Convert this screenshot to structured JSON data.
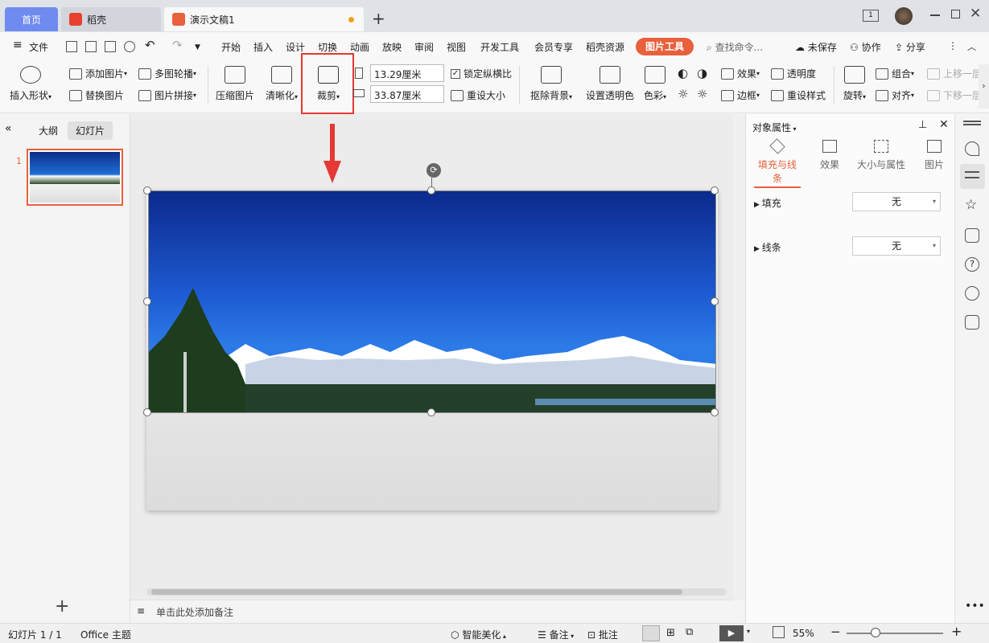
{
  "tabs": {
    "home": "首页",
    "daoke": "稻壳",
    "doc": "演示文稿1",
    "new_tab": "+"
  },
  "window": {
    "page_indicator": "1"
  },
  "menu": {
    "file": "文件",
    "items": [
      "开始",
      "插入",
      "设计",
      "切换",
      "动画",
      "放映",
      "审阅",
      "视图",
      "开发工具",
      "会员专享",
      "稻壳资源"
    ],
    "picture_tools": "图片工具",
    "search": "查找命令...",
    "unsaved": "未保存",
    "collab": "协作",
    "share": "分享"
  },
  "ribbon": {
    "insert_shape": "插入形状",
    "add_picture": "添加图片",
    "replace_picture": "替换图片",
    "multi_carousel": "多图轮播",
    "picture_collage": "图片拼接",
    "compress": "压缩图片",
    "sharpen": "清晰化",
    "crop": "裁剪",
    "height": "13.29厘米",
    "width": "33.87厘米",
    "lock_ratio": "锁定纵横比",
    "reset_size": "重设大小",
    "remove_bg": "抠除背景",
    "set_transparent": "设置透明色",
    "color": "色彩",
    "effects": "效果",
    "transparency": "透明度",
    "border": "边框",
    "reset_style": "重设样式",
    "rotate": "旋转",
    "group": "组合",
    "align": "对齐",
    "bring_forward": "上移一层",
    "send_backward": "下移一层"
  },
  "left_panel": {
    "outline": "大纲",
    "slides": "幻灯片",
    "slide_number": "1",
    "add": "+"
  },
  "notes": {
    "placeholder": "单击此处添加备注"
  },
  "right_panel": {
    "title": "对象属性",
    "tabs": [
      "填充与线条",
      "效果",
      "大小与属性",
      "图片"
    ],
    "fill_label": "填充",
    "fill_value": "无",
    "line_label": "线条",
    "line_value": "无"
  },
  "status": {
    "slide_info": "幻灯片 1 / 1",
    "theme": "Office 主题",
    "beautify": "智能美化",
    "notes": "备注",
    "comments": "批注",
    "zoom": "55%"
  },
  "colors": {
    "accent": "#e8603c",
    "home_tab": "#6f8bf0",
    "highlight": "#e53935"
  }
}
